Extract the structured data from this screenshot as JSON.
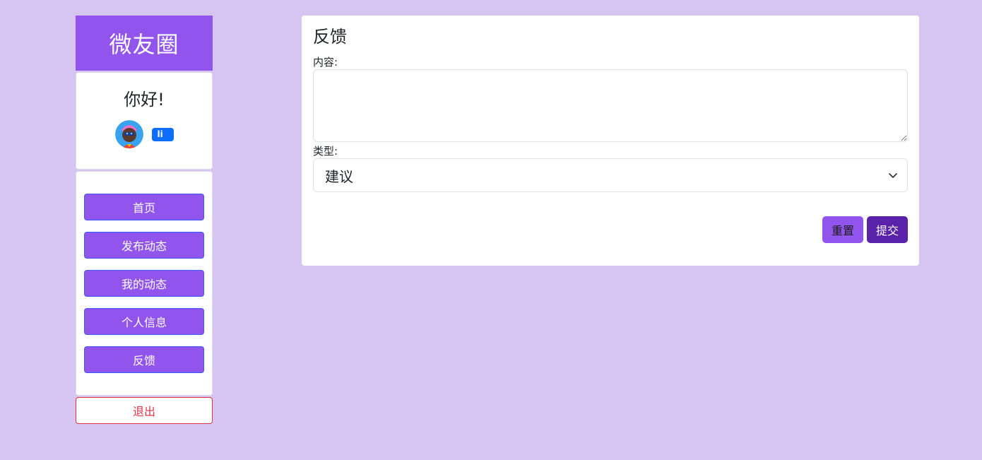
{
  "brand": {
    "title": "微友圈",
    "color": "#9155ee"
  },
  "user": {
    "greeting": "你好!",
    "avatar_icon": "cartoon-avatar-icon",
    "badge": "li"
  },
  "nav": {
    "items": [
      {
        "label": "首页"
      },
      {
        "label": "发布动态"
      },
      {
        "label": "我的动态"
      },
      {
        "label": "个人信息"
      },
      {
        "label": "反馈"
      }
    ],
    "logout_label": "退出"
  },
  "feedback": {
    "title": "反馈",
    "content_label": "内容:",
    "content_value": "",
    "type_label": "类型:",
    "type_selected": "建议",
    "reset_label": "重置",
    "submit_label": "提交"
  },
  "colors": {
    "background": "#d6c5f0",
    "primary": "#9155ee",
    "submit": "#5a22a8",
    "danger": "#dc3545",
    "badge": "#0d6efd"
  }
}
